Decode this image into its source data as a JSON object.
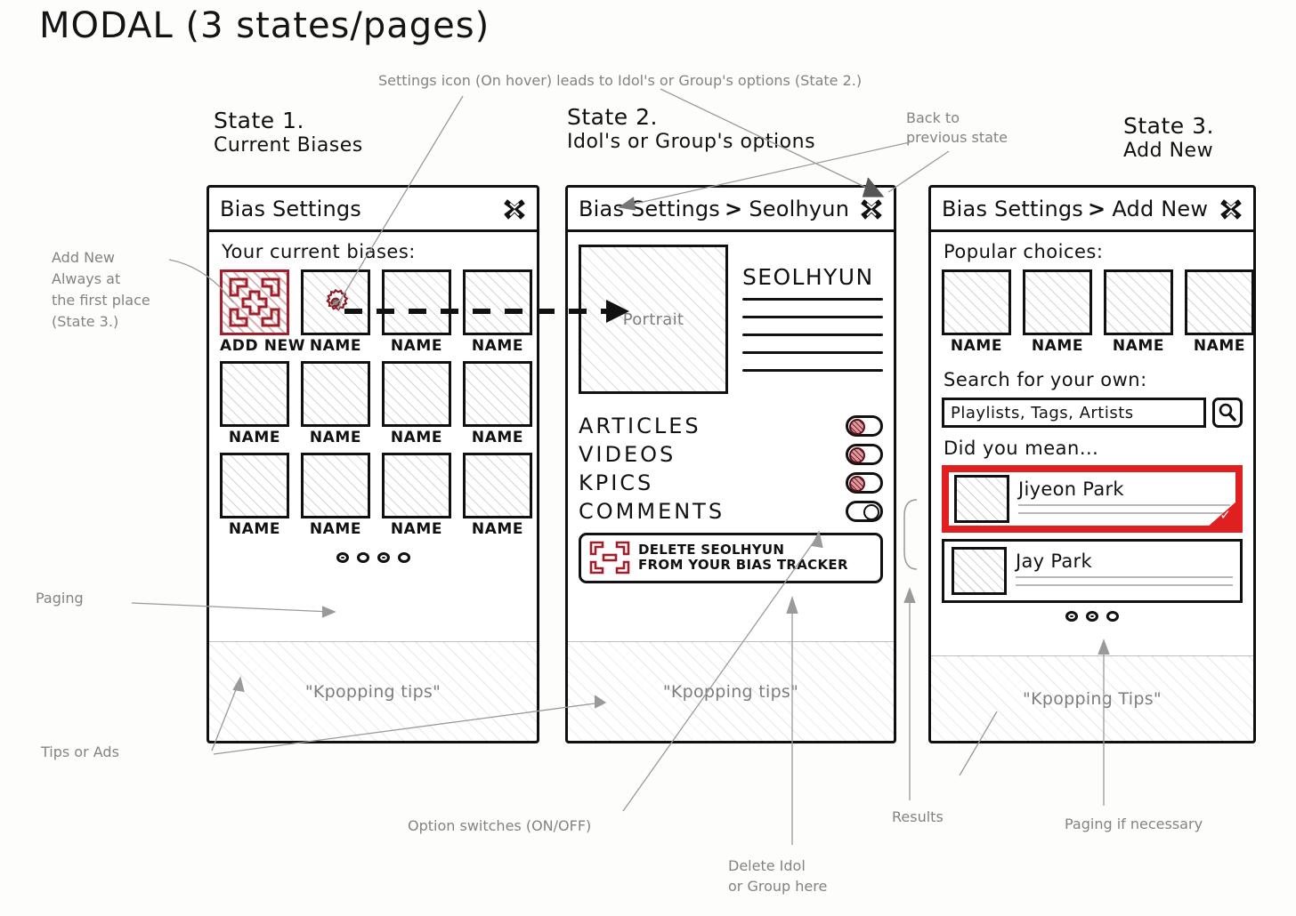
{
  "title": "MODAL (3 states/pages)",
  "annotations": {
    "settings_icon": "Settings icon (On hover) leads to Idol's or Group's options (State 2.)",
    "back_to_prev": "Back to\nprevious state",
    "add_new_note": "Add New\nAlways at\nthe first place\n(State 3.)",
    "paging": "Paging",
    "tips_or_ads": "Tips or Ads",
    "option_switches": "Option switches (ON/OFF)",
    "delete_idol": "Delete Idol\nor Group here",
    "results": "Results",
    "paging_if_necessary": "Paging if necessary"
  },
  "states": [
    {
      "caption": "State 1.",
      "subcaption": "Current Biases",
      "header": {
        "title": "Bias Settings",
        "crumb": null,
        "close_icon": "close-icon"
      },
      "section_label": "Your current biases:",
      "rows": [
        [
          {
            "name": "ADD NEW",
            "kind": "add-new"
          },
          {
            "name": "NAME",
            "kind": "gear"
          },
          {
            "name": "NAME",
            "kind": "plain"
          },
          {
            "name": "NAME",
            "kind": "plain"
          }
        ],
        [
          {
            "name": "NAME",
            "kind": "plain"
          },
          {
            "name": "NAME",
            "kind": "plain"
          },
          {
            "name": "NAME",
            "kind": "plain"
          },
          {
            "name": "NAME",
            "kind": "plain"
          }
        ],
        [
          {
            "name": "NAME",
            "kind": "plain"
          },
          {
            "name": "NAME",
            "kind": "plain"
          },
          {
            "name": "NAME",
            "kind": "plain"
          },
          {
            "name": "NAME",
            "kind": "plain"
          }
        ]
      ],
      "paging": {
        "count": 4,
        "active": 0
      },
      "ad_text": "\"Kpopping tips\""
    },
    {
      "caption": "State 2.",
      "subcaption": "Idol's or Group's options",
      "header": {
        "title": "Bias Settings",
        "crumb": "Seolhyun",
        "close_icon": "close-icon"
      },
      "portrait_label": "Portrait",
      "idol_name": "SEOLHYUN",
      "meta_lines": 5,
      "options": [
        {
          "label": "ARTICLES",
          "state": "on"
        },
        {
          "label": "VIDEOS",
          "state": "on"
        },
        {
          "label": "KPICS",
          "state": "on"
        },
        {
          "label": "COMMENTS",
          "state": "off"
        }
      ],
      "delete_button": {
        "line1": "DELETE SEOLHYUN",
        "line2": "FROM YOUR BIAS TRACKER",
        "icon": "delete-marker-icon"
      },
      "ad_text": "\"Kpopping tips\""
    },
    {
      "caption": "State 3.",
      "subcaption": "Add New",
      "header": {
        "title": "Bias Settings",
        "crumb": "Add New",
        "close_icon": "close-icon"
      },
      "section_label": "Popular choices:",
      "popular": [
        {
          "name": "NAME"
        },
        {
          "name": "NAME"
        },
        {
          "name": "NAME"
        },
        {
          "name": "NAME"
        }
      ],
      "search_label": "Search for your own:",
      "search_placeholder": "Playlists, Tags, Artists",
      "search_icon": "search-icon",
      "did_you_mean_label": "Did you mean...",
      "results": [
        {
          "name": "Jiyeon Park",
          "selected": true
        },
        {
          "name": "Jay Park",
          "selected": false
        }
      ],
      "paging": {
        "count": 3,
        "active": 1
      },
      "ad_text": "\"Kpopping Tips\""
    }
  ],
  "colors": {
    "ink": "#111111",
    "pencil": "#838383",
    "highlight_red": "#e02020",
    "accent_dark_red": "#9e1f2a"
  }
}
